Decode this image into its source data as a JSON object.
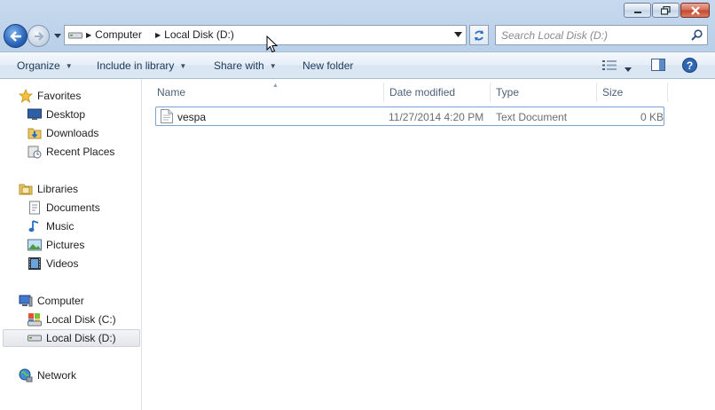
{
  "window": {
    "caption_buttons": [
      "minimize",
      "restore",
      "close"
    ]
  },
  "address": {
    "crumbs": [
      "Computer",
      "Local Disk (D:)"
    ]
  },
  "search": {
    "placeholder": "Search Local Disk (D:)"
  },
  "toolbar": {
    "organize": "Organize",
    "include_in_library": "Include in library",
    "share_with": "Share with",
    "new_folder": "New folder"
  },
  "nav": {
    "favorites": "Favorites",
    "desktop": "Desktop",
    "downloads": "Downloads",
    "recent_places": "Recent Places",
    "libraries": "Libraries",
    "documents": "Documents",
    "music": "Music",
    "pictures": "Pictures",
    "videos": "Videos",
    "computer": "Computer",
    "local_disk_c": "Local Disk (C:)",
    "local_disk_d": "Local Disk (D:)",
    "network": "Network"
  },
  "columns": {
    "name": "Name",
    "date_modified": "Date modified",
    "type": "Type",
    "size": "Size"
  },
  "files": [
    {
      "name": "vespa",
      "date_modified": "11/27/2014 4:20 PM",
      "type": "Text Document",
      "size": "0 KB"
    }
  ],
  "colors": {
    "accent": "#1e395b",
    "selection_border": "#7da2ce",
    "toolbar_bg": "#dce7f4"
  }
}
